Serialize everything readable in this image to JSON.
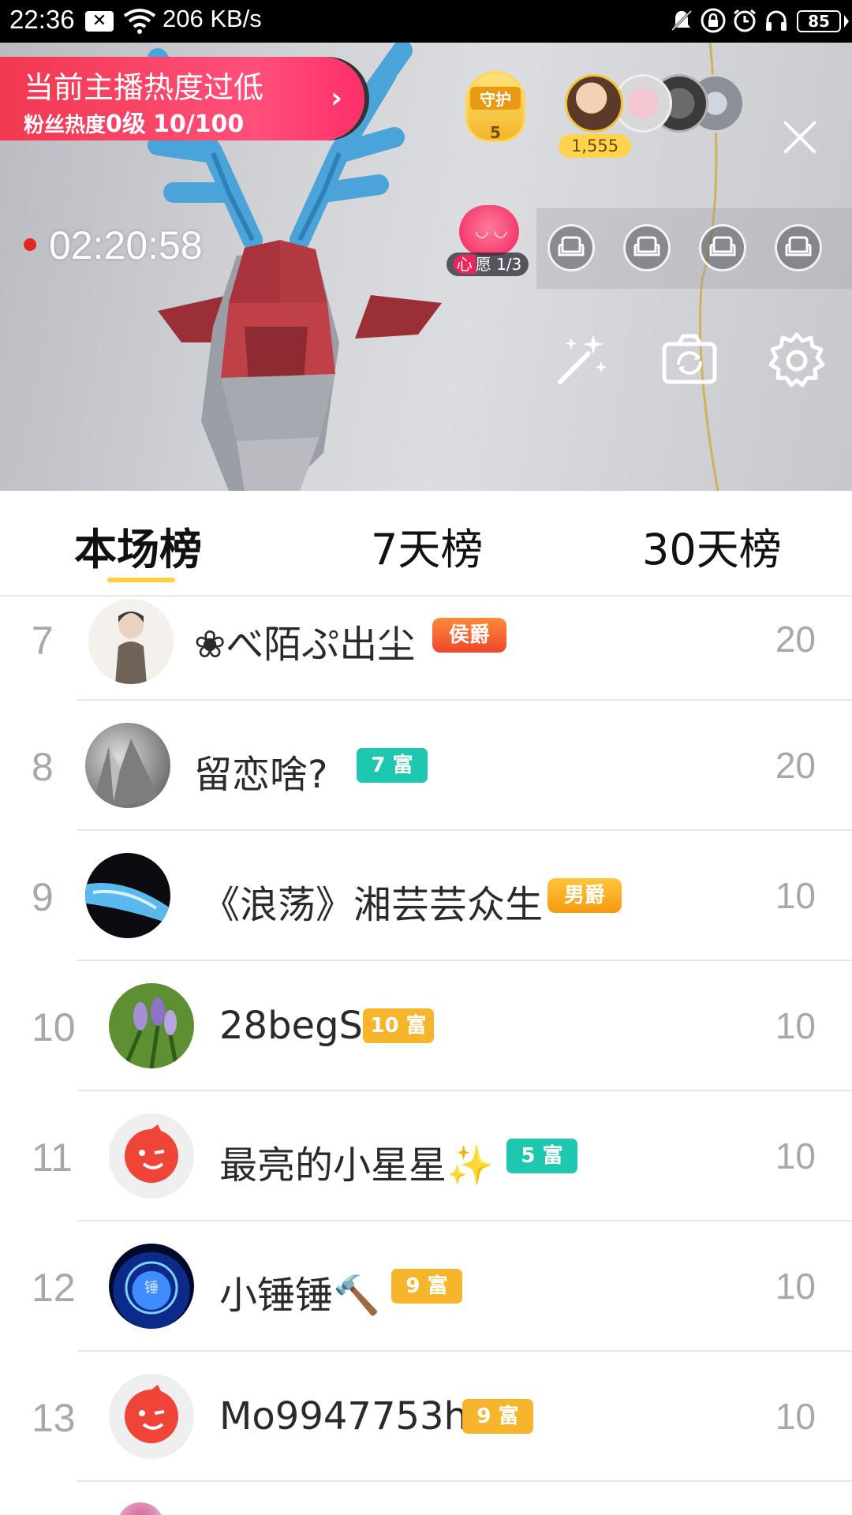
{
  "status_bar": {
    "time": "22:36",
    "net_speed": "206 KB/s",
    "battery": "85",
    "icons": [
      "close-notification-icon",
      "wifi-icon",
      "mute-icon",
      "lock-icon",
      "alarm-icon",
      "headphones-icon",
      "battery-icon"
    ]
  },
  "live": {
    "heat_banner": {
      "line1": "当前主播热度过低",
      "line2_prefix": "粉丝热度",
      "line2_level": "0级",
      "line2_progress": "10/100"
    },
    "guard": {
      "label": "守护",
      "count": "5"
    },
    "viewer_count": "1,555",
    "record_time": "02:20:58",
    "wish": {
      "label_hl": "心",
      "label_rest": "愿 1/3"
    }
  },
  "tabs": [
    {
      "label": "本场榜",
      "active": true
    },
    {
      "label": "7天榜",
      "active": false
    },
    {
      "label": "30天榜",
      "active": false
    }
  ],
  "rows": [
    {
      "rank": "7",
      "name": "❀べ陌ぷ出尘",
      "badge": "侯爵",
      "badge_style": "title-orange",
      "score": "20",
      "avatar": "cartoon-figure"
    },
    {
      "rank": "8",
      "name": "留恋啥?",
      "badge": "7 富",
      "badge_style": "teal",
      "score": "20",
      "avatar": "rock-photo"
    },
    {
      "rank": "9",
      "name": "《浪荡》湘芸芸众生",
      "badge": "男爵",
      "badge_style": "title-yellow",
      "score": "10",
      "avatar": "blue-object"
    },
    {
      "rank": "10",
      "name": "28begS",
      "badge": "10 富",
      "badge_style": "gold",
      "score": "10",
      "avatar": "flowers"
    },
    {
      "rank": "11",
      "name": "最亮的小星星✨",
      "badge": "5 富",
      "badge_style": "teal",
      "score": "10",
      "avatar": "default-red"
    },
    {
      "rank": "12",
      "name": "小锤锤🔨",
      "badge": "9 富",
      "badge_style": "gold",
      "score": "10",
      "avatar": "blue-orb"
    },
    {
      "rank": "13",
      "name": "Mo9947753h",
      "badge": "9 富",
      "badge_style": "gold",
      "score": "10",
      "avatar": "default-red"
    }
  ],
  "colors": {
    "accent_yellow": "#ffcf3d",
    "heat_pink": "#f2384f",
    "teal_badge": "#1ec8b0",
    "gold_badge": "#f6b52a"
  }
}
